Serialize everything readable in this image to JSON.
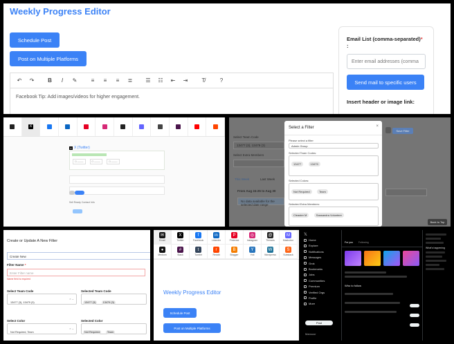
{
  "top": {
    "title": "Weekly Progress Editor",
    "schedule_label": "Schedule Post",
    "multi_label": "Post on Multiple Platforms",
    "editor_text": "Facebook Tip: Add images/videos for higher engagement.",
    "email_label": "Email List (comma-separated)",
    "email_required": "*",
    "email_colon": ":",
    "email_placeholder": "Enter email addresses (comma",
    "send_label": "Send mail to specific users",
    "insert_label": "Insert header or image link:"
  },
  "x_share": {
    "platforms": [
      "",
      "X",
      "",
      "",
      "",
      "",
      "",
      "",
      "",
      "",
      "",
      ""
    ],
    "post_title": "X (Twitter)",
    "meta_text": "Sell Ready Contact Info",
    "send_label": "Post"
  },
  "filter_modal": {
    "title": "Select a Filter",
    "close": "×",
    "bg_team_code_label": "Select Team Code",
    "bg_team_codes": "13477 (3), 13479 (3)",
    "bg_extra_label": "Select Extra Members",
    "bg_this_week": "This Week",
    "bg_last_week": "Last Week",
    "bg_range": "From Aug 24-25 to Aug 30",
    "bg_no_data": "No data available for the selected date range",
    "bg_save": "Save Filter",
    "bg_back_top": "Back to Top",
    "select_label": "Please select a filter",
    "selected_filter": "Admin Group",
    "codes_label": "Selected Team Codes:",
    "codes": [
      "13477",
      "13479"
    ],
    "colors_label": "Selected Colors:",
    "colors": [
      "Not Required",
      "Team"
    ],
    "extra_label": "Selected Extra Members:",
    "extras": [
      "Cleaster M",
      "Sassandra Volunteer"
    ]
  },
  "create_filter": {
    "title": "Create or Update A New Filter",
    "create_new": "Create New",
    "name_label": "Filter Name",
    "name_required": "*",
    "name_placeholder": "Enter Filter name",
    "name_error": "Name field is required",
    "team_code_label": "Select Team Code",
    "team_codes_value": "13477 (3), 13479 (3)",
    "selected_team_code_label": "Selected Team Code",
    "selected_team_codes": [
      "13477 (3)",
      "13479 (3)"
    ],
    "color_label": "Select Color",
    "color_value": "Not Required, Team",
    "selected_color_label": "Selected Color",
    "selected_colors": [
      "Not Required",
      "Team"
    ]
  },
  "mini_editor": {
    "platforms": [
      {
        "label": "Email",
        "glyph": "✉",
        "color": "#111111"
      },
      {
        "label": "Twitter",
        "glyph": "X",
        "color": "#000000"
      },
      {
        "label": "Facebook",
        "glyph": "f",
        "color": "#1877f2"
      },
      {
        "label": "LinkedIn",
        "glyph": "in",
        "color": "#0a66c2"
      },
      {
        "label": "Pinterest",
        "glyph": "P",
        "color": "#e60023"
      },
      {
        "label": "Instagram",
        "glyph": "◎",
        "color": "#d62976"
      },
      {
        "label": "Threads",
        "glyph": "@",
        "color": "#222222"
      },
      {
        "label": "Mastodon",
        "glyph": "M",
        "color": "#6364ff"
      },
      {
        "label": "Medium",
        "glyph": "●",
        "color": "#111111"
      },
      {
        "label": "Slack",
        "glyph": "#",
        "color": "#4a154b"
      },
      {
        "label": "Tumblr",
        "glyph": "t",
        "color": "#35465c"
      },
      {
        "label": "Reddit",
        "glyph": "r",
        "color": "#ff4500"
      },
      {
        "label": "Blogger",
        "glyph": "B",
        "color": "#f57d00"
      },
      {
        "label": "Yoti",
        "glyph": "Y",
        "color": "#2875bc"
      },
      {
        "label": "Wordpress",
        "glyph": "W",
        "color": "#21759b"
      },
      {
        "label": "Substack",
        "glyph": "S",
        "color": "#ff6719"
      }
    ],
    "title": "Weekly Progress Editor",
    "schedule_label": "Schedule Post",
    "multi_label": "Post on Multiple Platforms"
  },
  "dark_x": {
    "nav": [
      "Home",
      "Explore",
      "Notifications",
      "Messages",
      "Grok",
      "Bookmarks",
      "Jobs",
      "Communities",
      "Premium",
      "Verified Orgs",
      "Profile",
      "More"
    ],
    "post_label": "Post",
    "user": "Mansoor",
    "tabs": [
      "For you",
      "Following"
    ],
    "who_to_follow": "Who to follow",
    "whats_happening": "What's happening"
  },
  "colors": {
    "accent": "#3b82f6",
    "error": "#e53e3e"
  }
}
